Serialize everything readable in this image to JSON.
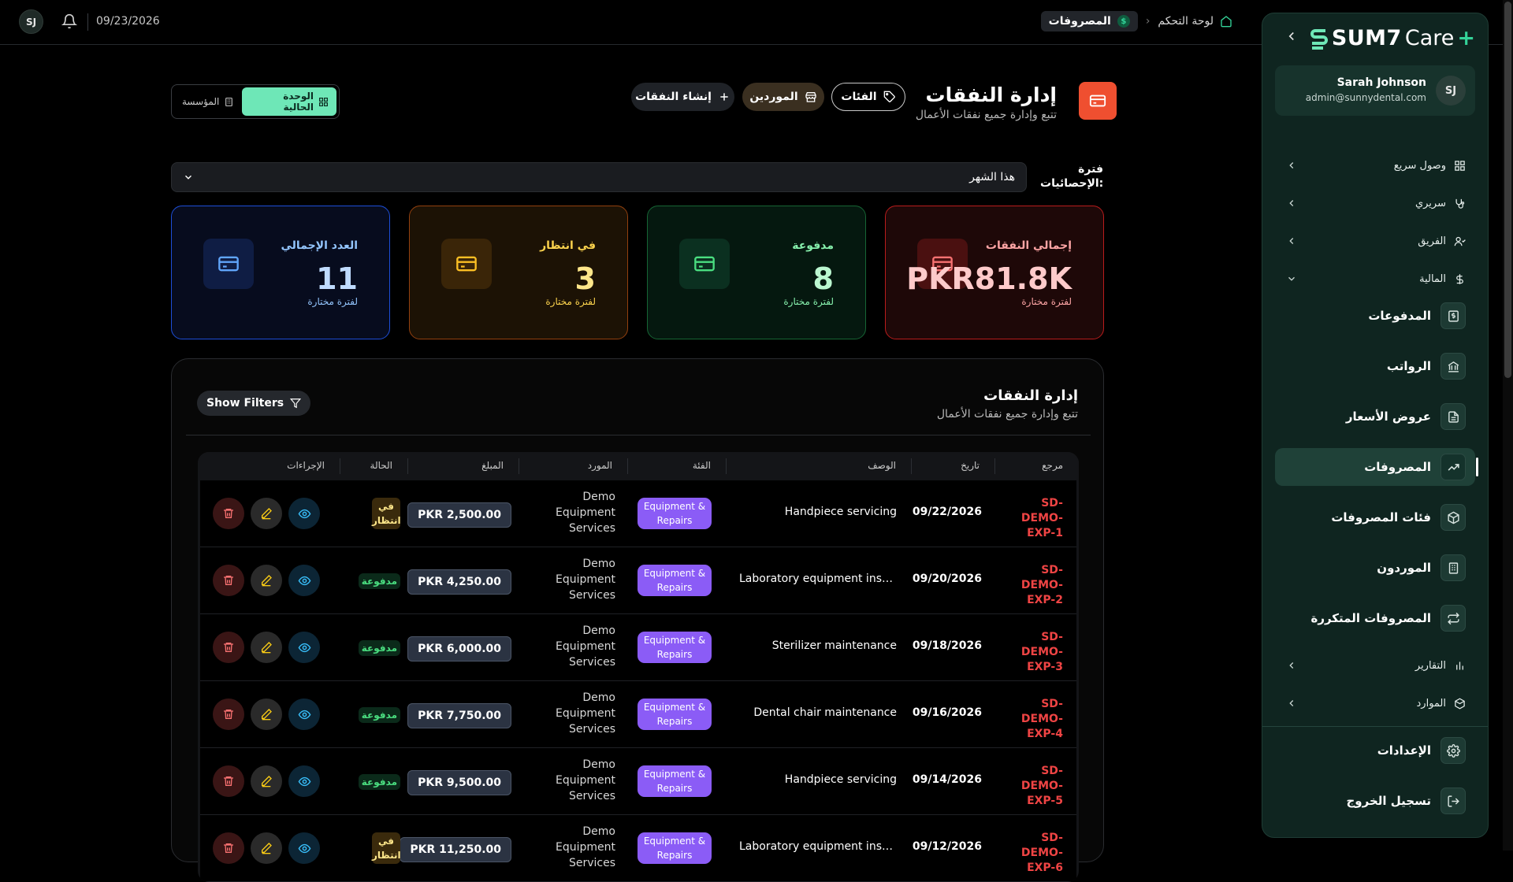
{
  "topbar": {
    "avatar_initials": "SJ",
    "date": "09/23/2026",
    "breadcrumb_home": "لوحة التحكم",
    "breadcrumb_current": "المصروفات"
  },
  "sidebar": {
    "brand": "SUM7",
    "brand_suffix": "Care",
    "brand_plus": "+",
    "user": {
      "initials": "SJ",
      "name": "Sarah Johnson",
      "email": "admin@sunnydental.com"
    },
    "groups": [
      {
        "label": "وصول سريع",
        "icon": "grid-icon"
      },
      {
        "label": "سريري",
        "icon": "stethoscope-icon"
      },
      {
        "label": "الفريق",
        "icon": "users-icon"
      },
      {
        "label": "المالية",
        "icon": "dollar-icon"
      }
    ],
    "finance_items": [
      {
        "label": "المدفوعات",
        "icon": "receipt-dollar-icon"
      },
      {
        "label": "الرواتب",
        "icon": "bank-icon"
      },
      {
        "label": "عروض الأسعار",
        "icon": "document-icon"
      },
      {
        "label": "المصروفات",
        "icon": "trending-up-icon",
        "active": true
      },
      {
        "label": "فئات المصروفات",
        "icon": "box-icon"
      },
      {
        "label": "الموردون",
        "icon": "building-icon"
      },
      {
        "label": "المصروفات المتكررة",
        "icon": "repeat-icon"
      }
    ],
    "lower_groups": [
      {
        "label": "التقارير",
        "icon": "bar-chart-icon"
      },
      {
        "label": "الموارد",
        "icon": "package-icon"
      }
    ],
    "settings_label": "الإعدادات",
    "logout_label": "تسجيل الخروج"
  },
  "header": {
    "title": "إدارة النفقات",
    "subtitle": "تتبع وإدارة جميع نفقات الأعمال",
    "categories_btn": "الفئات",
    "suppliers_btn": "الموردين",
    "create_btn": "إنشاء النفقات",
    "scope_current": "الوحدة الحالية",
    "scope_org": "المؤسسة"
  },
  "period": {
    "label": "فترة الإحصائيات:",
    "value": "هذا الشهر"
  },
  "stats": [
    {
      "title": "إجمالي النفقات",
      "value": "PKR81.8K",
      "sub": "لفترة مختارة",
      "color": "#ef4444"
    },
    {
      "title": "مدفوعة",
      "value": "8",
      "sub": "لفترة مختارة",
      "color": "#22c55e"
    },
    {
      "title": "في انتظار",
      "value": "3",
      "sub": "لفترة مختارة",
      "color": "#f59e0b"
    },
    {
      "title": "العدد الإجمالي",
      "value": "11",
      "sub": "لفترة مختارة",
      "color": "#3b82f6"
    }
  ],
  "panel": {
    "title": "إدارة النفقات",
    "subtitle": "تتبع وإدارة جميع نفقات الأعمال",
    "filters_btn": "Show Filters"
  },
  "table": {
    "columns": [
      "مرجع",
      "تاريخ",
      "الوصف",
      "الفئة",
      "المورد",
      "المبلغ",
      "الحالة",
      "الإجراءات"
    ],
    "rows": [
      {
        "ref": "SD-DEMO-EXP-1",
        "date": "09/22/2026",
        "desc": "Handpiece servicing",
        "cat": "Equipment & Repairs",
        "supplier": "Demo Equipment Services",
        "amount": "PKR 2,500.00",
        "status": "في انتظار",
        "status_kind": "pending"
      },
      {
        "ref": "SD-DEMO-EXP-2",
        "date": "09/20/2026",
        "desc": "Laboratory equipment inspection",
        "cat": "Equipment & Repairs",
        "supplier": "Demo Equipment Services",
        "amount": "PKR 4,250.00",
        "status": "مدفوعة",
        "status_kind": "paid"
      },
      {
        "ref": "SD-DEMO-EXP-3",
        "date": "09/18/2026",
        "desc": "Sterilizer maintenance",
        "cat": "Equipment & Repairs",
        "supplier": "Demo Equipment Services",
        "amount": "PKR 6,000.00",
        "status": "مدفوعة",
        "status_kind": "paid"
      },
      {
        "ref": "SD-DEMO-EXP-4",
        "date": "09/16/2026",
        "desc": "Dental chair maintenance",
        "cat": "Equipment & Repairs",
        "supplier": "Demo Equipment Services",
        "amount": "PKR 7,750.00",
        "status": "مدفوعة",
        "status_kind": "paid"
      },
      {
        "ref": "SD-DEMO-EXP-5",
        "date": "09/14/2026",
        "desc": "Handpiece servicing",
        "cat": "Equipment & Repairs",
        "supplier": "Demo Equipment Services",
        "amount": "PKR 9,500.00",
        "status": "مدفوعة",
        "status_kind": "paid"
      },
      {
        "ref": "SD-DEMO-EXP-6",
        "date": "09/12/2026",
        "desc": "Laboratory equipment inspection",
        "cat": "Equipment & Repairs",
        "supplier": "Demo Equipment Services",
        "amount": "PKR 11,250.00",
        "status": "في انتظار",
        "status_kind": "pending"
      }
    ]
  }
}
